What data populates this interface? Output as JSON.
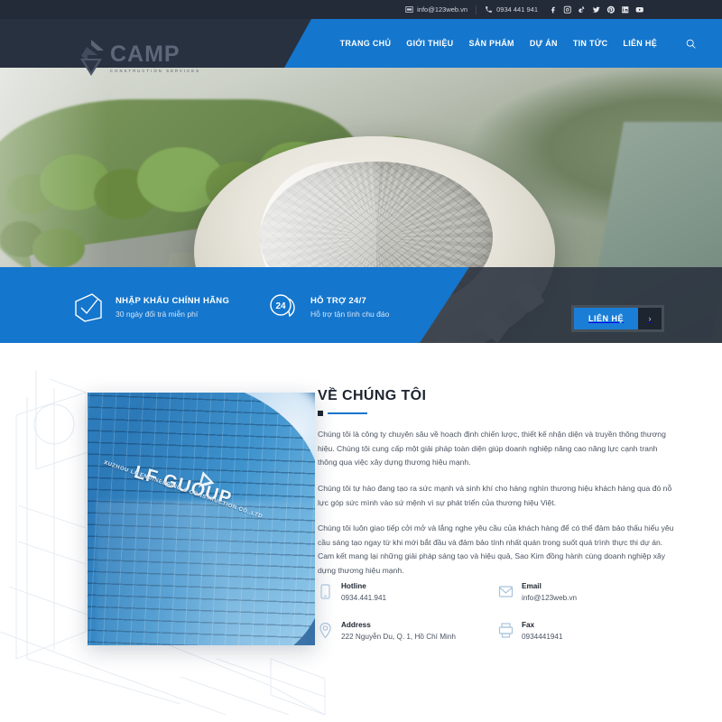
{
  "topbar": {
    "email": "info@123web.vn",
    "phone": "0934 441 941",
    "socials": [
      {
        "name": "facebook-icon"
      },
      {
        "name": "instagram-icon"
      },
      {
        "name": "tiktok-icon"
      },
      {
        "name": "twitter-icon"
      },
      {
        "name": "pinterest-icon"
      },
      {
        "name": "linkedin-icon"
      },
      {
        "name": "youtube-icon"
      }
    ]
  },
  "brand": {
    "title": "CAMP",
    "tagline": "CONSTRUCTION SERVICES"
  },
  "nav": {
    "items": [
      {
        "label": "TRANG CHỦ"
      },
      {
        "label": "GIỚI THIỆU"
      },
      {
        "label": "SẢN PHẨM"
      },
      {
        "label": "DỰ ÁN"
      },
      {
        "label": "TIN TỨC"
      },
      {
        "label": "LIÊN HỆ"
      }
    ],
    "search_icon": "search-icon"
  },
  "hero": {
    "alt": "Aerial rendering of a circular domed stadium surrounded by trees and walkways"
  },
  "features": [
    {
      "icon": "check-box-icon",
      "title": "NHẬP KHẨU CHÍNH HÃNG",
      "subtitle": "30 ngày đổi trả miễn phí"
    },
    {
      "icon": "support-24-icon",
      "title": "HỖ TRỢ 24/7",
      "subtitle": "Hỗ trợ tận tình chu đáo"
    }
  ],
  "cta": {
    "label": "LIÊN HỆ",
    "arrow": "›"
  },
  "about": {
    "heading": "VỀ CHÚNG TÔI",
    "photo": {
      "building_name": "LF GUOUP",
      "building_sub": "XUZHOU LF ENGINEERING & CONSTRUCTION CO.,LTD"
    },
    "paragraphs": [
      "Chúng tôi là công ty chuyên sâu về hoạch định chiến lược, thiết kế nhận diện và truyền thông thương hiệu. Chúng tôi cung cấp một giải pháp toàn diện giúp doanh nghiệp nâng cao năng lực cạnh tranh thông qua việc xây dựng thương hiệu mạnh.",
      "Chúng tôi tự hào đang tạo ra sức mạnh và sinh khí cho hàng nghìn thương hiệu khách hàng qua đó nỗ lực góp sức mình vào sứ mệnh vì sự phát triển của thương hiệu Việt.",
      "Chúng tôi luôn giao tiếp cởi mở và lắng nghe yêu cầu của khách hàng để có thể đảm bảo thấu hiểu yêu cầu sáng tạo ngay từ khi mới bắt đầu và đảm bảo tính nhất quán trong suốt quá trình thực thi dự án. Cam kết mang lại những giải pháp sáng tạo và hiệu quả, Sao Kim đồng hành cùng doanh nghiệp xây dựng thương hiệu mạnh."
    ],
    "contacts": [
      {
        "icon": "mobile-phone-icon",
        "label": "Hotline",
        "value": "0934.441.941"
      },
      {
        "icon": "envelope-icon",
        "label": "Email",
        "value": "info@123web.vn"
      },
      {
        "icon": "map-pin-icon",
        "label": "Address",
        "value": "222 Nguyễn Du, Q. 1, Hồ Chí Minh"
      },
      {
        "icon": "fax-icon",
        "label": "Fax",
        "value": "0934441941"
      }
    ]
  },
  "colors": {
    "brand_blue": "#1476cd",
    "dark_navy": "#28313f",
    "topbar": "#242b38"
  }
}
